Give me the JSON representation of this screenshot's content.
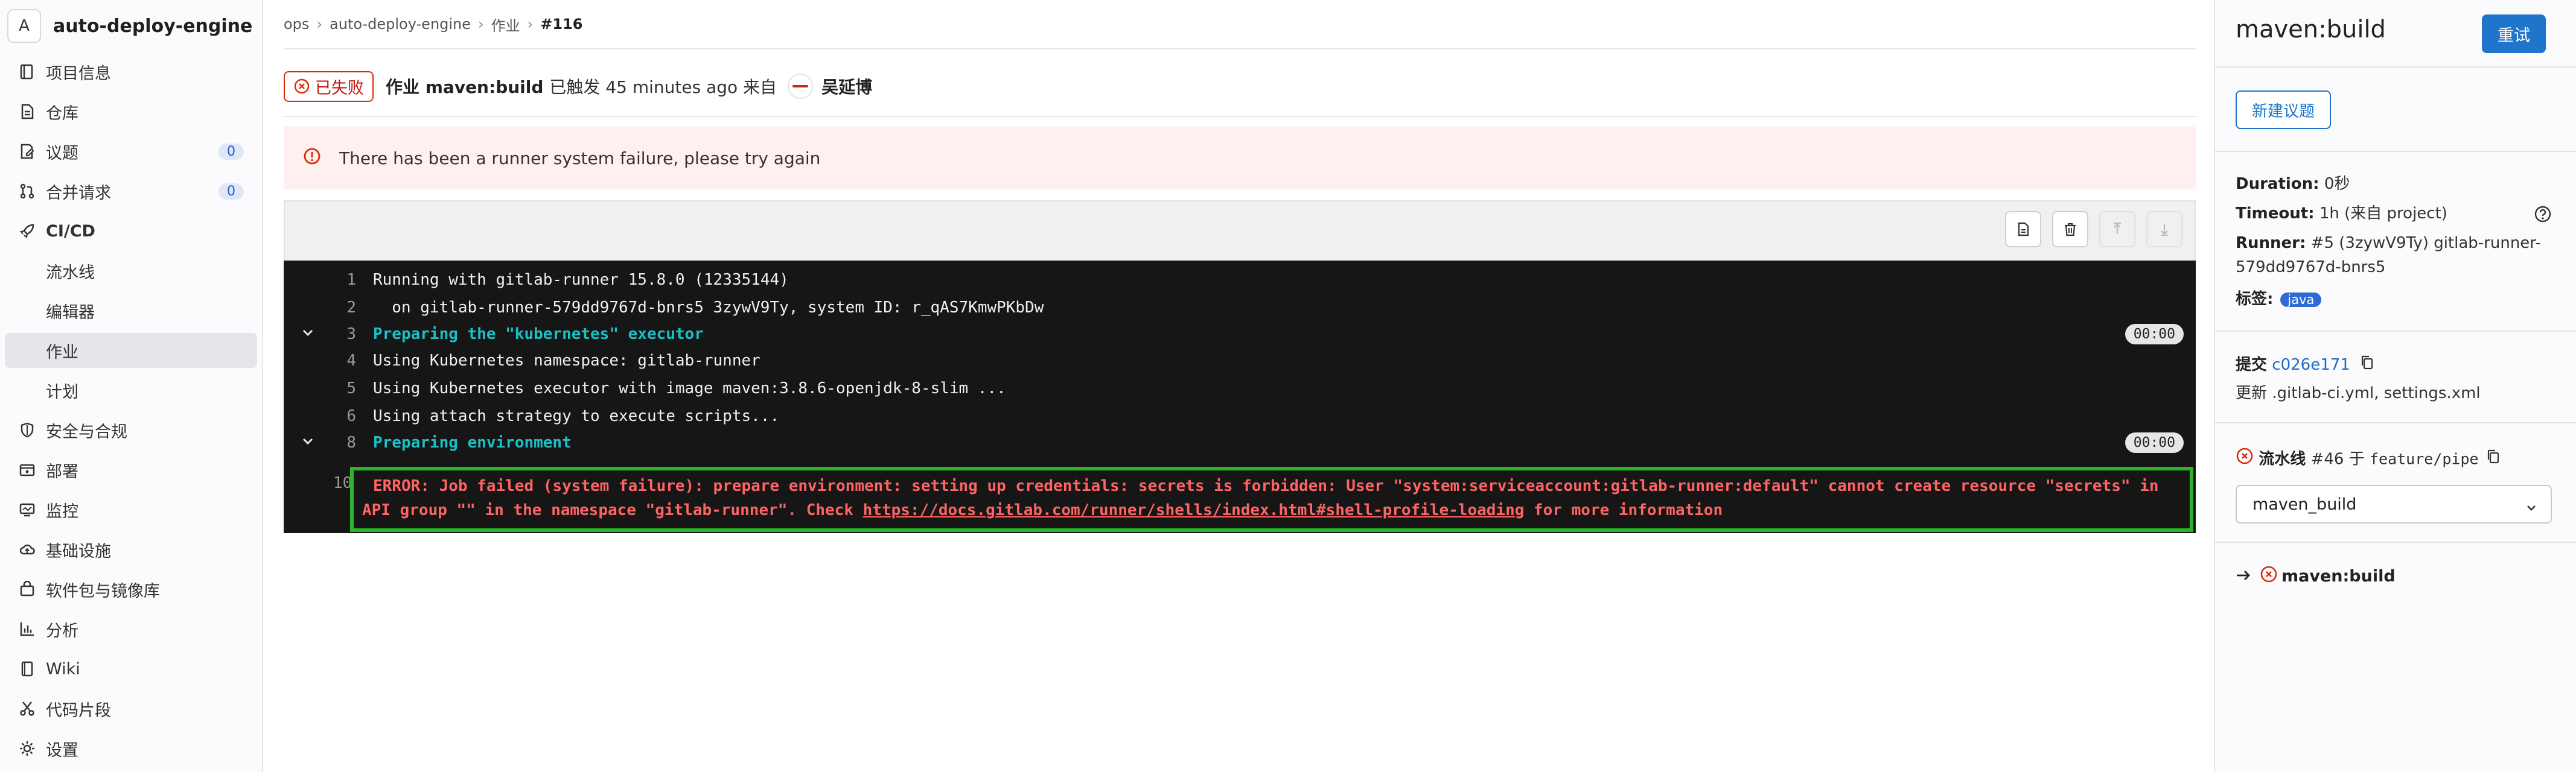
{
  "sidebar": {
    "project_initial": "A",
    "project_name": "auto-deploy-engine",
    "items": [
      {
        "label": "项目信息",
        "icon": "project-icon"
      },
      {
        "label": "仓库",
        "icon": "repository-icon"
      },
      {
        "label": "议题",
        "icon": "issues-icon",
        "count": "0"
      },
      {
        "label": "合并请求",
        "icon": "merge-request-icon",
        "count": "0"
      },
      {
        "label": "CI/CD",
        "icon": "rocket-icon"
      },
      {
        "label": "流水线"
      },
      {
        "label": "编辑器"
      },
      {
        "label": "作业"
      },
      {
        "label": "计划"
      },
      {
        "label": "安全与合规",
        "icon": "shield-icon"
      },
      {
        "label": "部署",
        "icon": "deployments-icon"
      },
      {
        "label": "监控",
        "icon": "monitor-icon"
      },
      {
        "label": "基础设施",
        "icon": "cloud-icon"
      },
      {
        "label": "软件包与镜像库",
        "icon": "package-icon"
      },
      {
        "label": "分析",
        "icon": "chart-icon"
      },
      {
        "label": "Wiki",
        "icon": "book-icon"
      },
      {
        "label": "代码片段",
        "icon": "snippet-scissors-icon"
      },
      {
        "label": "设置",
        "icon": "gear-icon"
      }
    ]
  },
  "breadcrumb": [
    "ops",
    "auto-deploy-engine",
    "作业",
    "#116"
  ],
  "header": {
    "status": "已失败",
    "job_label": "作业 maven:build",
    "triggered": "已触发 45 minutes ago 来自",
    "user": "吴延博"
  },
  "alert": "There has been a runner system failure, please try again",
  "log": {
    "lines": [
      {
        "n": "1",
        "text": "Running with gitlab-runner 15.8.0 (12335144)"
      },
      {
        "n": "2",
        "text": "  on gitlab-runner-579dd9767d-bnrs5 3zywV9Ty, system ID: r_qAS7KmwPKbDw"
      },
      {
        "n": "3",
        "text": "Preparing the \"kubernetes\" executor",
        "duration": "00:00"
      },
      {
        "n": "4",
        "text": "Using Kubernetes namespace: gitlab-runner"
      },
      {
        "n": "5",
        "text": "Using Kubernetes executor with image maven:3.8.6-openjdk-8-slim ..."
      },
      {
        "n": "6",
        "text": "Using attach strategy to execute scripts..."
      },
      {
        "n": "8",
        "text": "Preparing environment",
        "duration": "00:00"
      }
    ],
    "error_num": "10",
    "error_line1": "ERROR: Job failed (system failure): prepare environment: setting up credentials: secrets is forbidden: User \"system:serviceaccount:gitlab-runner:default\" cannot create resource \"secrets\" in",
    "error_line2_pre": "API group \"\" in the namespace \"gitlab-runner\". Check ",
    "error_link": "https://docs.gitlab.com/runner/shells/index.html#shell-profile-loading",
    "error_line2_post": " for more information"
  },
  "right": {
    "title": "maven:build",
    "retry": "重试",
    "new_issue": "新建议题",
    "duration_label": "Duration:",
    "duration_value": "0秒",
    "timeout_label": "Timeout:",
    "timeout_value": "1h (来自 project)",
    "runner_label": "Runner:",
    "runner_value_1": "#5 (3zywV9Ty) gitlab-runner-",
    "runner_value_2": "579dd9767d-bnrs5",
    "tags_label": "标签:",
    "tag": "java",
    "commit_label": "提交",
    "commit_sha": "c026e171",
    "commit_msg": "更新 .gitlab-ci.yml, settings.xml",
    "pipeline_label": "流水线",
    "pipeline_id": "#46",
    "pipeline_on": "于",
    "pipeline_branch": "feature/pipe",
    "stage_select": "maven_build",
    "job_name": "maven:build"
  },
  "colors": {
    "accent": "#1f75cb",
    "danger": "#dd2b0e",
    "success_box": "#2bb52b",
    "log_bg": "#161616"
  }
}
